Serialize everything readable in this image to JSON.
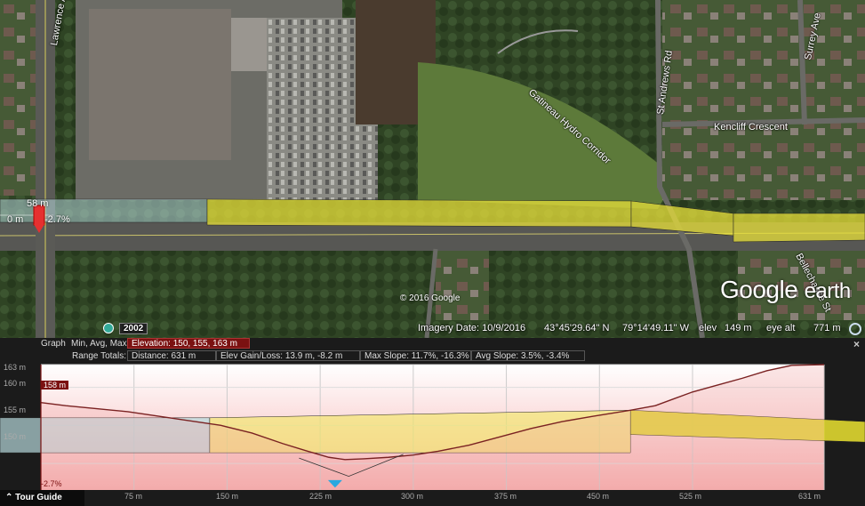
{
  "map": {
    "labels": {
      "lawrence": "Lawrence Ave E",
      "gatineau": "Gatineau Hydro Corridor",
      "standrews": "St Andrews Rd",
      "surrey": "Surrey Ave",
      "kencliff": "Kencliff Crescent",
      "bellechasse": "Bellechasse St"
    },
    "overlay": {
      "top_elev": "58 m",
      "zero": "0 m",
      "pct": "-2.7%"
    },
    "copyright": "© 2016 Google",
    "logo": {
      "google": "Google",
      "earth": "earth"
    },
    "status": {
      "year": "2002",
      "imagery": "Imagery Date: 10/9/2016",
      "lat": "43°45'29.64\" N",
      "lon": "79°14'49.11\" W",
      "elev_label": "elev",
      "elev": "149 m",
      "eye_label": "eye alt",
      "eye": "771 m"
    }
  },
  "profile": {
    "graph_label": "Graph",
    "stats_label": "Min, Avg, Max:",
    "elevation": "Elevation: 150, 155, 163 m",
    "totals_label": "Range Totals:",
    "distance": "Distance: 631 m",
    "gain_loss": "Elev Gain/Loss: 13.9 m, -8.2 m",
    "max_slope": "Max Slope: 11.7%, -16.3%",
    "avg_slope": "Avg Slope: 3.5%, -3.4%",
    "close": "×",
    "tour_guide": "Tour Guide",
    "cursor_elev": "158 m",
    "cursor_slope": "-2.7%"
  },
  "chart_data": {
    "type": "area",
    "xlabel": "",
    "ylabel": "",
    "y_ticks": [
      "163 m",
      "160 m",
      "155 m",
      "150 m"
    ],
    "y_tick_values": [
      163,
      160,
      155,
      150
    ],
    "x_ticks": [
      "75 m",
      "150 m",
      "225 m",
      "300 m",
      "375 m",
      "450 m",
      "525 m",
      "631 m"
    ],
    "x_tick_values": [
      75,
      150,
      225,
      300,
      375,
      450,
      525,
      631
    ],
    "xlim": [
      0,
      631
    ],
    "ylim": [
      146.5,
      163
    ],
    "series": [
      {
        "x": [
          0,
          20,
          45,
          70,
          95,
          120,
          145,
          170,
          195,
          215,
          232,
          245,
          260,
          280,
          300,
          320,
          345,
          370,
          395,
          420,
          445,
          475,
          495,
          510,
          525,
          545,
          565,
          585,
          605,
          631
        ],
        "values": [
          158.0,
          157.6,
          157.2,
          156.8,
          156.2,
          155.6,
          155.0,
          154.0,
          152.6,
          151.6,
          150.8,
          150.5,
          150.6,
          150.8,
          151.1,
          151.6,
          152.4,
          153.5,
          154.6,
          155.5,
          156.2,
          157.0,
          157.6,
          158.5,
          159.4,
          160.3,
          161.2,
          162.2,
          162.9,
          163.0
        ]
      }
    ],
    "slope_color_low": "#f5b0b0",
    "slope_color_high": "#ffffff",
    "line_color": "#7a2222"
  }
}
